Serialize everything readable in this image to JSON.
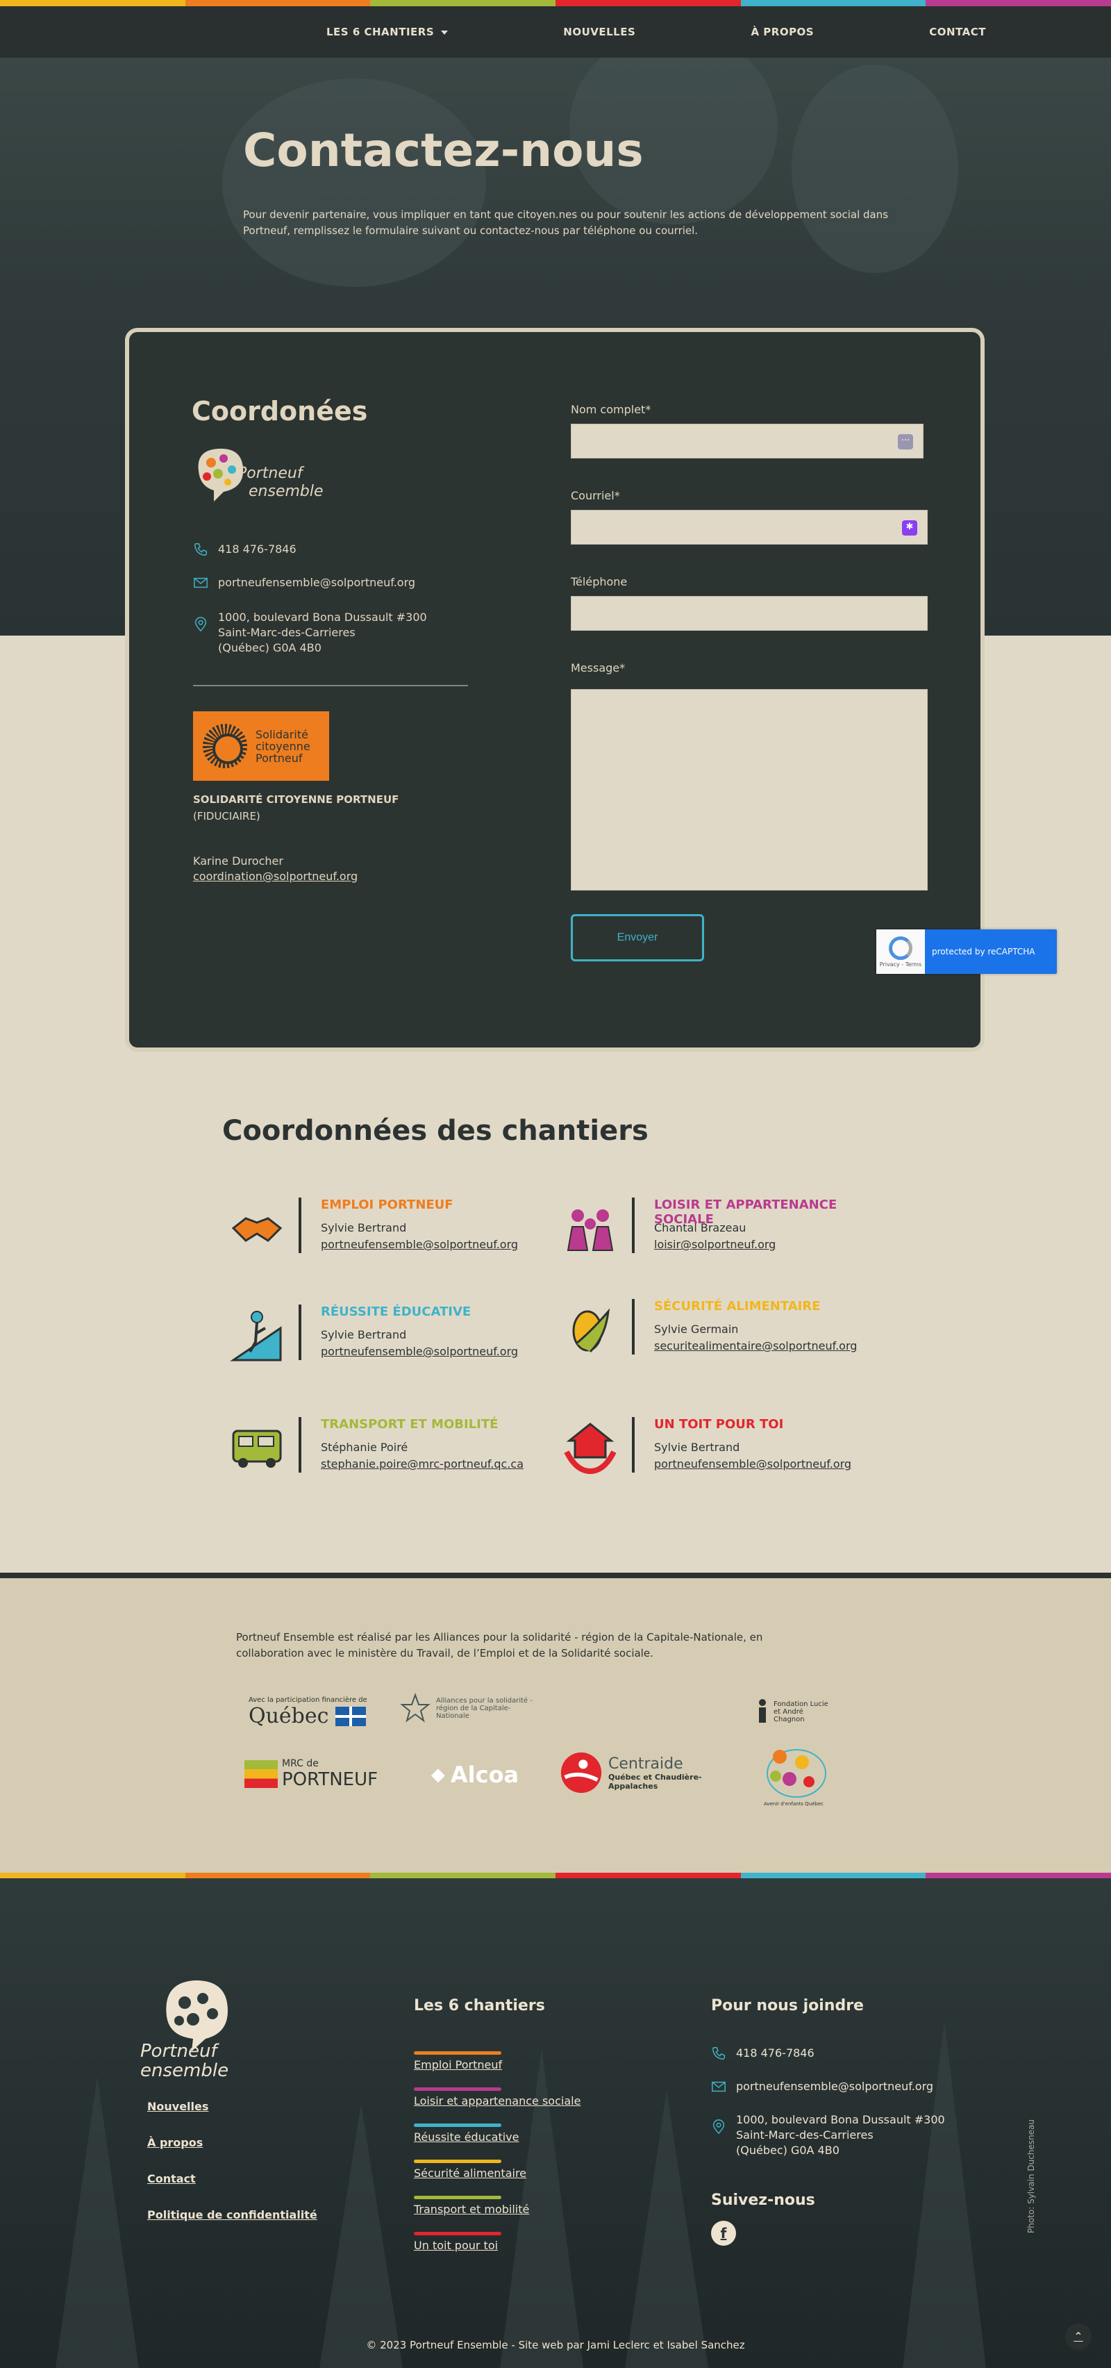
{
  "rainbow_colors": [
    "#f1b61e",
    "#ee7d1f",
    "#a3b93a",
    "#e1262d",
    "#3fb3c9",
    "#b93a8f"
  ],
  "nav": {
    "items": [
      "LES 6 CHANTIERS",
      "NOUVELLES",
      "À PROPOS",
      "CONTACT"
    ]
  },
  "hero": {
    "title": "Contactez-nous",
    "intro": "Pour devenir partenaire, vous impliquer en tant que citoyen.nes ou pour soutenir les actions de développement social dans Portneuf, remplissez le formulaire suivant ou contactez-nous par téléphone ou courriel."
  },
  "card": {
    "title": "Coordonées",
    "logo_text": "Portneuf ensemble",
    "phone": "418 476-7846",
    "email": "portneufensemble@solportneuf.org",
    "address": [
      "1000, boulevard Bona Dussault #300",
      "Saint-Marc-des-Carrieres",
      "(Québec) G0A 4B0"
    ],
    "fiducie_logo_text": [
      "Solidarité",
      "citoyenne",
      "Portneuf"
    ],
    "fiducie_name": "SOLIDARITÉ CITOYENNE PORTNEUF",
    "fiducie_sub": "(FIDUCIAIRE)",
    "fiducie_contact": "Karine Durocher",
    "fiducie_email": "coordination@solportneuf.org"
  },
  "form": {
    "name_label": "Nom complet*",
    "email_label": "Courriel*",
    "phone_label": "Téléphone",
    "message_label": "Message*",
    "submit_label": "Envoyer",
    "recaptcha_text": "protected by reCAPTCHA",
    "recaptcha_sub": "Privacy - Terms"
  },
  "chantiers": {
    "title": "Coordonnées des chantiers",
    "items": [
      {
        "title": "EMPLOI PORTNEUF",
        "name": "Sylvie Bertrand",
        "email": "portneufensemble@solportneuf.org",
        "color": "#ee7d1f",
        "icon": "handshake-icon"
      },
      {
        "title": "LOISIR ET APPARTENANCE SOCIALE",
        "name": "Chantal Brazeau",
        "email": "loisir@solportneuf.org",
        "color": "#b93a8f",
        "icon": "people-group-icon"
      },
      {
        "title": "RÉUSSITE ÉDUCATIVE",
        "name": "Sylvie Bertrand",
        "email": "portneufensemble@solportneuf.org",
        "color": "#3fb3c9",
        "icon": "climber-icon"
      },
      {
        "title": "SÉCURITÉ ALIMENTAIRE",
        "name": "Sylvie Germain",
        "email": "securitealimentaire@solportneuf.org",
        "color": "#f1b61e",
        "icon": "corn-icon"
      },
      {
        "title": "TRANSPORT ET MOBILITÉ",
        "name": "Stéphanie Poiré",
        "email": "stephanie.poire@mrc-portneuf.qc.ca",
        "color": "#a3b93a",
        "icon": "bus-icon"
      },
      {
        "title": "UN TOIT POUR TOI",
        "name": "Sylvie Bertrand",
        "email": "portneufensemble@solportneuf.org",
        "color": "#e1262d",
        "icon": "house-hands-icon"
      }
    ]
  },
  "partners": {
    "text": "Portneuf Ensemble est réalisé par les Alliances pour la solidarité - région de la Capitale-Nationale, en collaboration avec le ministère du Travail, de l’Emploi et de la Solidarité sociale.",
    "quebec_small": "Avec la participation financière de",
    "quebec": "Québec",
    "alliances": "Alliances pour la solidarité - région de la Capitale-Nationale",
    "fondation": "Fondation Lucie et André Chagnon",
    "mrc_small": "MRC de",
    "mrc": "PORTNEUF",
    "alcoa": "Alcoa",
    "centraide": "Centraide",
    "centraide_sub": "Québec et Chaudière-Appalaches",
    "avenir": "Avenir d'enfants Québec"
  },
  "footer": {
    "logo_text": "Portneuf ensemble",
    "links": [
      "Nouvelles",
      "À propos",
      "Contact",
      "Politique de confidentialité"
    ],
    "chantiers_title": "Les 6 chantiers",
    "chantiers": [
      "Emploi Portneuf",
      "Loisir et appartenance sociale",
      "Réussite éducative",
      "Sécurité alimentaire",
      "Transport et mobilité",
      "Un toit pour toi"
    ],
    "chantier_colors": [
      "#ee7d1f",
      "#b93a8f",
      "#3fb3c9",
      "#f1b61e",
      "#a3b93a",
      "#e1262d"
    ],
    "contact_title": "Pour nous joindre",
    "phone": "418 476-7846",
    "email": "portneufensemble@solportneuf.org",
    "address": [
      "1000, boulevard Bona Dussault #300",
      "Saint-Marc-des-Carrieres",
      "(Québec) G0A 4B0"
    ],
    "follow_title": "Suivez-nous",
    "facebook": "f",
    "photo_credit": "Photo: Sylvain Duchesneau",
    "copyright": "© 2023 Portneuf Ensemble - Site web par Jami Leclerc et Isabel Sanchez"
  }
}
